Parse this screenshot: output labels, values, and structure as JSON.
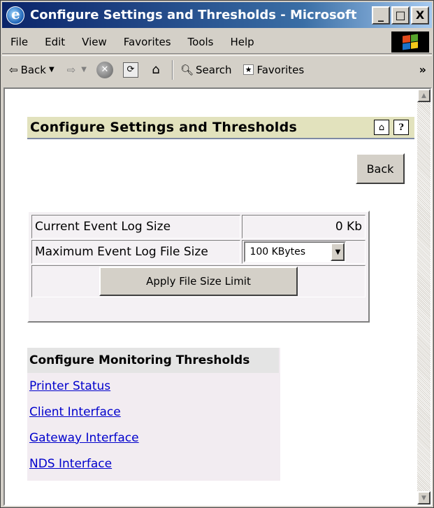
{
  "window": {
    "title": "Configure Settings and Thresholds - Microsoft I...",
    "minimize": "_",
    "maximize": "□",
    "close": "X"
  },
  "menu": [
    "File",
    "Edit",
    "View",
    "Favorites",
    "Tools",
    "Help"
  ],
  "toolbar": {
    "back_label": "Back",
    "search_label": "Search",
    "favorites_label": "Favorites",
    "more": "»"
  },
  "page": {
    "title": "Configure Settings and Thresholds",
    "back_button": "Back",
    "help_icon": "?"
  },
  "settings": {
    "current_log_label": "Current Event Log Size",
    "current_log_value": "0 Kb",
    "max_log_label": "Maximum Event Log File Size",
    "max_log_selected": "100 KBytes",
    "apply_button": "Apply File Size Limit"
  },
  "monitoring": {
    "title": "Configure Monitoring Thresholds",
    "links": [
      "Printer Status",
      "Client Interface",
      "Gateway Interface",
      "NDS Interface"
    ]
  },
  "colors": {
    "titlebar": "#0a246a",
    "header_bg": "#e2e2bd",
    "link": "#0000cc"
  }
}
